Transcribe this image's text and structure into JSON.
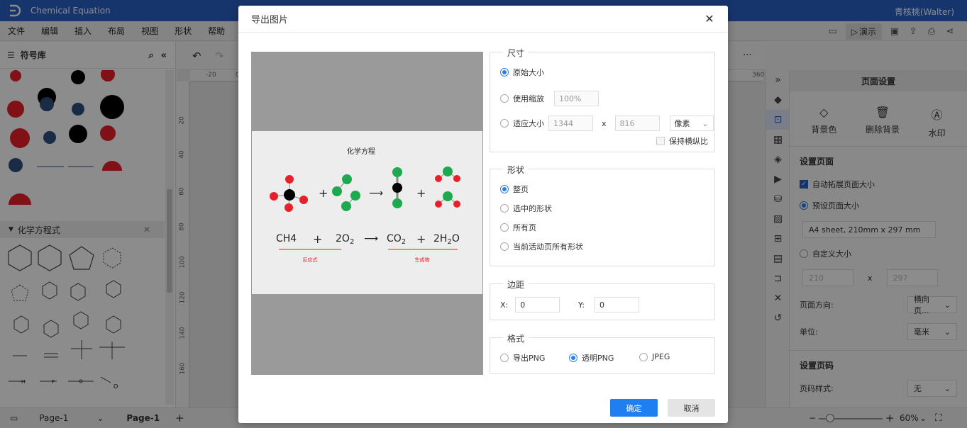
{
  "app": {
    "title": "Chemical Equation",
    "user": "青核桃(Walter)"
  },
  "menu": [
    "文件",
    "编辑",
    "插入",
    "布局",
    "视图",
    "形状",
    "帮助"
  ],
  "toolbar": {
    "present_label": "演示"
  },
  "left_panel": {
    "title": "符号库",
    "section_title": "化学方程式"
  },
  "ruler": {
    "h_ticks": [
      "-20",
      "0",
      "360"
    ],
    "v_ticks": [
      "20",
      "40",
      "60",
      "80",
      "100",
      "120",
      "140",
      "160",
      "180",
      "200"
    ]
  },
  "right_panel": {
    "title": "页面设置",
    "tools": [
      {
        "label": "背景色",
        "icon": "paint-bucket-icon"
      },
      {
        "label": "删除背景",
        "icon": "trash-icon"
      },
      {
        "label": "水印",
        "icon": "watermark-icon"
      }
    ],
    "page_section_title": "设置页面",
    "auto_expand_label": "自动拓展页面大小",
    "preset_size_label": "预设页面大小",
    "preset_size_value": "A4 sheet, 210mm x 297 mm",
    "custom_size_label": "自定义大小",
    "custom_w": "210",
    "custom_x": "x",
    "custom_h": "297",
    "orientation_label": "页面方向:",
    "orientation_value": "横向页...",
    "unit_label": "单位:",
    "unit_value": "毫米",
    "page_number_title": "设置页码",
    "page_number_style_label": "页码样式:",
    "page_number_style_value": "无"
  },
  "statusbar": {
    "page_tab_dropdown": "Page-1",
    "page_tab_active": "Page-1",
    "zoom": "60%"
  },
  "dialog": {
    "title": "导出图片",
    "preview": {
      "heading": "化学方程",
      "eq_left_1": "CH4",
      "plus": "+",
      "eq_left_2": "2O",
      "eq_left_2_sub": "2",
      "eq_right_1": "CO",
      "eq_right_1_sub": "2",
      "eq_right_2": "2H",
      "eq_right_2_sub": "2",
      "eq_right_2_tail": "O",
      "label_reactants": "反应式",
      "label_products": "生成物"
    },
    "size": {
      "legend": "尺寸",
      "original_label": "原始大小",
      "scale_label": "使用缩放",
      "scale_value": "100%",
      "fit_label": "适应大小",
      "fit_w": "1344",
      "fit_x": "x",
      "fit_h": "816",
      "unit_value": "像素",
      "keep_ratio_label": "保持横纵比"
    },
    "shape": {
      "legend": "形状",
      "whole_page_label": "整页",
      "selected_label": "选中的形状",
      "all_pages_label": "所有页",
      "current_active_label": "当前活动页所有形状"
    },
    "margin": {
      "legend": "边距",
      "x_label": "X:",
      "x_value": "0",
      "y_label": "Y:",
      "y_value": "0"
    },
    "format": {
      "legend": "格式",
      "png_label": "导出PNG",
      "transparent_png_label": "透明PNG",
      "jpeg_label": "JPEG"
    },
    "ok_label": "确定",
    "cancel_label": "取消"
  },
  "colors": {
    "brand": "#2b62c7",
    "primary_button": "#1f7ff0",
    "radio_on": "#2b7fe0",
    "atom_red": "#e8202a",
    "atom_green": "#1ea94e",
    "atom_black": "#000000",
    "underline_red": "#e8202a"
  }
}
